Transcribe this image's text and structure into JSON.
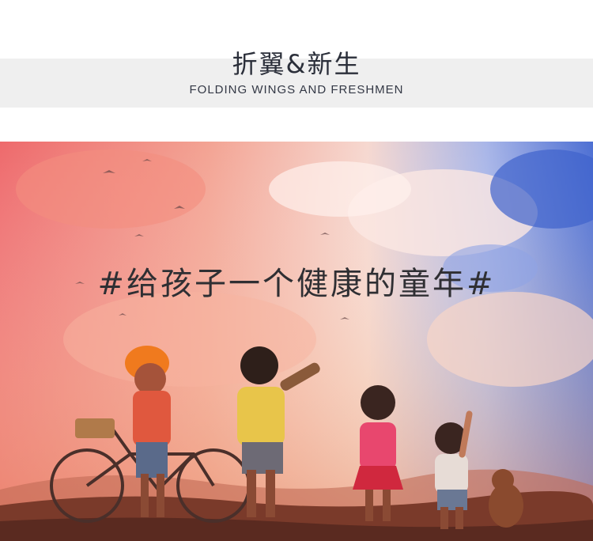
{
  "header": {
    "title_cn": "折翼&新生",
    "title_en": "FOLDING WINGS AND FRESHMEN"
  },
  "banner": {
    "slogan": "#给孩子一个健康的童年#"
  },
  "colors": {
    "header_band": "#efefef",
    "sky_top_right": "#4a6fd1",
    "sky_warm": "#f4a08f",
    "sky_red": "#e85a5a",
    "ground": "#7a3a2a"
  }
}
